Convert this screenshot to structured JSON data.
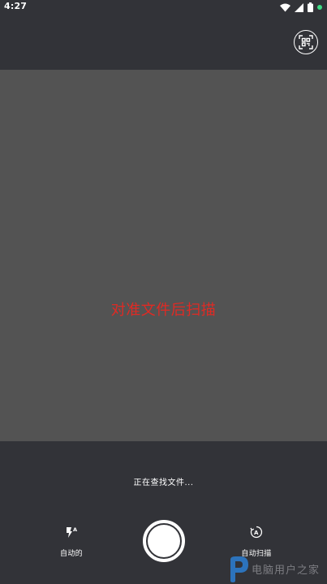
{
  "status_bar": {
    "time": "4:27",
    "icons": [
      "wifi-icon",
      "signal-icon",
      "battery-icon",
      "notification-dot-icon"
    ]
  },
  "toolbar": {
    "qr_icon": "qr-scan-icon"
  },
  "preview": {
    "hint": "对准文件后扫描"
  },
  "bottom": {
    "status_message": "正在查找文件...",
    "flash": {
      "label": "自动的",
      "icon": "flash-auto-icon"
    },
    "auto_scan": {
      "label": "自动扫描",
      "icon": "auto-scan-icon"
    },
    "shutter_icon": "shutter-button"
  },
  "watermark": {
    "text": "电脑用户之家",
    "icon": "watermark-logo-icon"
  },
  "colors": {
    "background": "#323338",
    "preview": "#535353",
    "hint": "#e02a24",
    "foreground": "#ffffff",
    "notification_dot": "#3ddc84"
  }
}
